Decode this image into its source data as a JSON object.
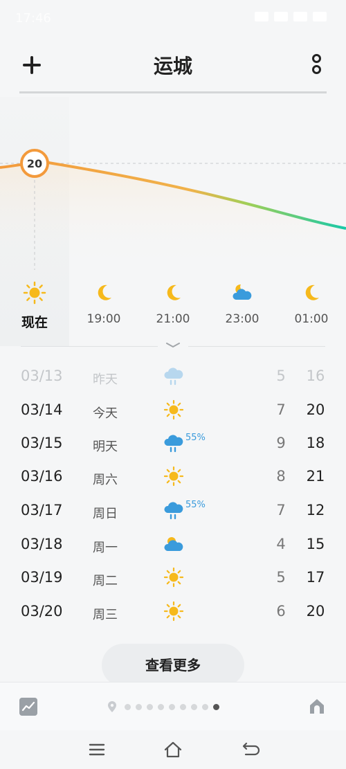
{
  "status_bar": {
    "time": "17:46"
  },
  "header": {
    "title": "运城",
    "add_label": "+",
    "menu_label": "更多"
  },
  "hourly": {
    "current_temp": "20",
    "hours": [
      {
        "label": "现在",
        "icon": "sun-icon"
      },
      {
        "label": "19:00",
        "icon": "moon-icon"
      },
      {
        "label": "21:00",
        "icon": "moon-icon"
      },
      {
        "label": "23:00",
        "icon": "moon-cloud-icon"
      },
      {
        "label": "01:00",
        "icon": "moon-icon"
      }
    ]
  },
  "daily": [
    {
      "date": "03/13",
      "weekday": "昨天",
      "icon": "rain-cloud-icon",
      "precip": "",
      "low": "5",
      "high": "16",
      "past": true
    },
    {
      "date": "03/14",
      "weekday": "今天",
      "icon": "sun-icon",
      "precip": "",
      "low": "7",
      "high": "20"
    },
    {
      "date": "03/15",
      "weekday": "明天",
      "icon": "rain-cloud-icon",
      "precip": "55%",
      "low": "9",
      "high": "18"
    },
    {
      "date": "03/16",
      "weekday": "周六",
      "icon": "sun-icon",
      "precip": "",
      "low": "8",
      "high": "21"
    },
    {
      "date": "03/17",
      "weekday": "周日",
      "icon": "rain-cloud-icon",
      "precip": "55%",
      "low": "7",
      "high": "12"
    },
    {
      "date": "03/18",
      "weekday": "周一",
      "icon": "sun-cloud-icon",
      "precip": "",
      "low": "4",
      "high": "15"
    },
    {
      "date": "03/19",
      "weekday": "周二",
      "icon": "sun-icon",
      "precip": "",
      "low": "5",
      "high": "17"
    },
    {
      "date": "03/20",
      "weekday": "周三",
      "icon": "sun-icon",
      "precip": "",
      "low": "6",
      "high": "20"
    }
  ],
  "more_button": "查看更多",
  "footer": {
    "page_count": 10,
    "active_page": 9
  },
  "colors": {
    "accent_orange": "#f39a3c",
    "line_green": "#18c8a8",
    "rain_blue": "#3a9bdc",
    "sun_yellow": "#f6b91c"
  }
}
